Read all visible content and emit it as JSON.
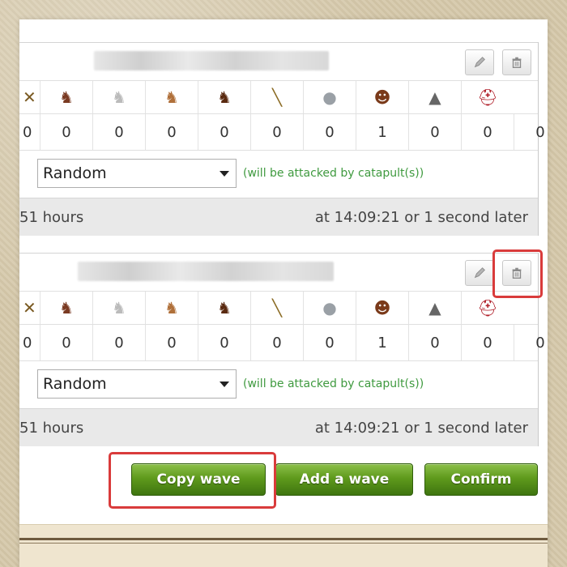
{
  "waves": [
    {
      "units": [
        {
          "icon": "ram-icon",
          "glyph": "✕",
          "color": "#7a5a22"
        },
        {
          "icon": "haeduan-icon",
          "glyph": "♞",
          "color": "#7a3a22"
        },
        {
          "icon": "white-horse-icon",
          "glyph": "♞",
          "color": "#bbbbbb"
        },
        {
          "icon": "brown-horse-icon",
          "glyph": "♞",
          "color": "#b0703a"
        },
        {
          "icon": "dark-horse-icon",
          "glyph": "♞",
          "color": "#5a2a10"
        },
        {
          "icon": "battering-ram-icon",
          "glyph": "╲",
          "color": "#8a6a22"
        },
        {
          "icon": "catapult-icon",
          "glyph": "●",
          "color": "#9aa0a6"
        },
        {
          "icon": "chieftain-icon",
          "glyph": "☻",
          "color": "#7a3a1a"
        },
        {
          "icon": "settler-icon",
          "glyph": "▲",
          "color": "#666666"
        },
        {
          "icon": "hero-icon",
          "glyph": "⛑",
          "color": "#b0202a"
        }
      ],
      "counts": [
        "0",
        "0",
        "0",
        "0",
        "0",
        "0",
        "0",
        "1",
        "0",
        "0",
        "0"
      ],
      "target": "Random",
      "hint": "(will be attacked by catapult(s))",
      "duration": "51 hours",
      "arrival": "at 14:09:21 or 1 second later"
    },
    {
      "units": [
        {
          "icon": "ram-icon",
          "glyph": "✕",
          "color": "#7a5a22"
        },
        {
          "icon": "haeduan-icon",
          "glyph": "♞",
          "color": "#7a3a22"
        },
        {
          "icon": "white-horse-icon",
          "glyph": "♞",
          "color": "#bbbbbb"
        },
        {
          "icon": "brown-horse-icon",
          "glyph": "♞",
          "color": "#b0703a"
        },
        {
          "icon": "dark-horse-icon",
          "glyph": "♞",
          "color": "#5a2a10"
        },
        {
          "icon": "battering-ram-icon",
          "glyph": "╲",
          "color": "#8a6a22"
        },
        {
          "icon": "catapult-icon",
          "glyph": "●",
          "color": "#9aa0a6"
        },
        {
          "icon": "chieftain-icon",
          "glyph": "☻",
          "color": "#7a3a1a"
        },
        {
          "icon": "settler-icon",
          "glyph": "▲",
          "color": "#666666"
        },
        {
          "icon": "hero-icon",
          "glyph": "⛑",
          "color": "#b0202a"
        }
      ],
      "counts": [
        "0",
        "0",
        "0",
        "0",
        "0",
        "0",
        "0",
        "1",
        "0",
        "0",
        "0"
      ],
      "target": "Random",
      "hint": "(will be attacked by catapult(s))",
      "duration": "51 hours",
      "arrival": "at 14:09:21 or 1 second later"
    }
  ],
  "buttons": {
    "copy_wave": "Copy wave",
    "add_wave": "Add a wave",
    "confirm": "Confirm"
  },
  "colors": {
    "accent_green": "#5f9a1c",
    "highlight_red": "#d93b3b",
    "hint_green": "#3f9a3f"
  }
}
